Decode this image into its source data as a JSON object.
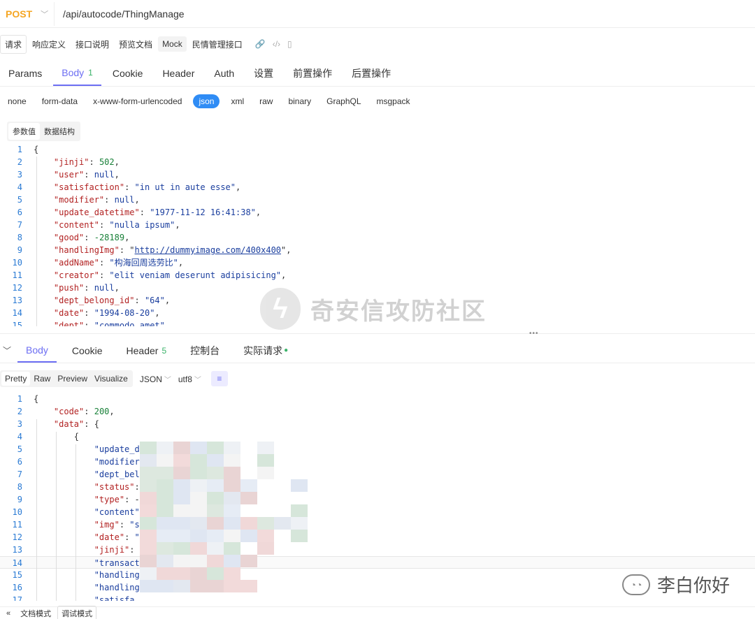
{
  "request": {
    "method": "POST",
    "url": "/api/autocode/ThingManage"
  },
  "doc_tabs": [
    "请求",
    "响应定义",
    "接口说明",
    "预览文档",
    "Mock"
  ],
  "api_name": "民情管理接口",
  "req_tabs": [
    {
      "label": "Params"
    },
    {
      "label": "Body",
      "badge": "1"
    },
    {
      "label": "Cookie"
    },
    {
      "label": "Header"
    },
    {
      "label": "Auth"
    },
    {
      "label": "设置"
    },
    {
      "label": "前置操作"
    },
    {
      "label": "后置操作"
    }
  ],
  "body_types": [
    "none",
    "form-data",
    "x-www-form-urlencoded",
    "json",
    "xml",
    "raw",
    "binary",
    "GraphQL",
    "msgpack"
  ],
  "body_type_selected": "json",
  "param_switch": [
    "参数值",
    "数据结构"
  ],
  "request_body_lines": [
    "{",
    "    \"jinji\": 502,",
    "    \"user\": null,",
    "    \"satisfaction\": \"in ut in aute esse\",",
    "    \"modifier\": null,",
    "    \"update_datetime\": \"1977-11-12 16:41:38\",",
    "    \"content\": \"nulla ipsum\",",
    "    \"good\": -28189,",
    "    \"handlingImg\": \"http://dummyimage.com/400x400\",",
    "    \"addName\": \"构海回周选劳比\",",
    "    \"creator\": \"elit veniam deserunt adipisicing\",",
    "    \"push\": null,",
    "    \"dept_belong_id\": \"64\",",
    "    \"date\": \"1994-08-20\",",
    "    \"dept\": \"commodo amet\""
  ],
  "resp_tabs": [
    {
      "label": "Body"
    },
    {
      "label": "Cookie"
    },
    {
      "label": "Header",
      "badge": "5"
    },
    {
      "label": "控制台"
    },
    {
      "label": "实际请求",
      "dot": true
    }
  ],
  "view_modes": [
    "Pretty",
    "Raw",
    "Preview",
    "Visualize"
  ],
  "format": "JSON",
  "encoding": "utf8",
  "response_lines": [
    "{",
    "    \"code\": 200,",
    "    \"data\": {",
    "        {",
    "            \"update_d",
    "            \"modifier",
    "            \"dept_bel",
    "            \"status\":",
    "            \"type\": -",
    "            \"content\"",
    "            \"img\": \"s",
    "            \"date\": \"",
    "            \"jinji\":",
    "            \"transact",
    "            \"handling",
    "            \"handling",
    "            \"satisfa"
  ],
  "watermark": "奇安信攻防社区",
  "author_watermark": "李白你好",
  "footer_tabs": [
    "文档模式",
    "调试模式"
  ],
  "colors": {
    "accent": "#6c6ef3",
    "method": "#f5a623",
    "json_pill": "#2f8cf5",
    "badge": "#3bb36a"
  }
}
